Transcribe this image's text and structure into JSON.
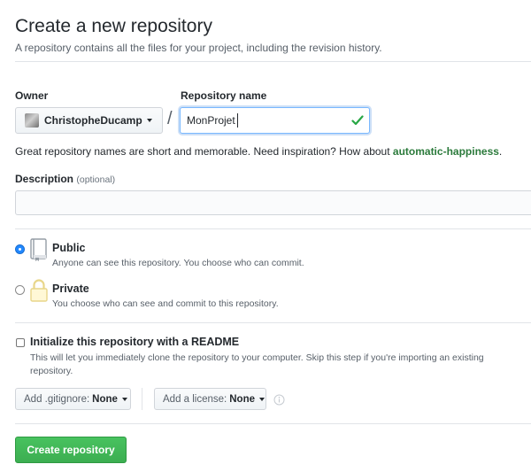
{
  "page": {
    "title": "Create a new repository",
    "subtitle": "A repository contains all the files for your project, including the revision history."
  },
  "owner": {
    "label": "Owner",
    "value": "ChristopheDucamp",
    "avatar_icon": "avatar-image"
  },
  "separator": "/",
  "repo_name": {
    "label": "Repository name",
    "value": "MonProjet",
    "valid_icon": "checkmark-icon"
  },
  "suggestion": {
    "text": "Great repository names are short and memorable. Need inspiration? How about ",
    "name": "automatic-happiness",
    "suffix": "."
  },
  "description": {
    "label": "Description",
    "optional": "(optional)",
    "value": ""
  },
  "visibility": {
    "public": {
      "title": "Public",
      "desc": "Anyone can see this repository. You choose who can commit.",
      "selected": true
    },
    "private": {
      "title": "Private",
      "desc": "You choose who can see and commit to this repository.",
      "selected": false
    }
  },
  "readme": {
    "title": "Initialize this repository with a README",
    "desc": "This will let you immediately clone the repository to your computer. Skip this step if you're importing an existing repository.",
    "checked": false
  },
  "gitignore": {
    "label": "Add .gitignore:",
    "value": "None"
  },
  "license": {
    "label": "Add a license:",
    "value": "None"
  },
  "submit": {
    "label": "Create repository"
  },
  "colors": {
    "accent_green": "#3cae51",
    "radio_blue": "#2188ff",
    "check_green": "#28a745"
  }
}
